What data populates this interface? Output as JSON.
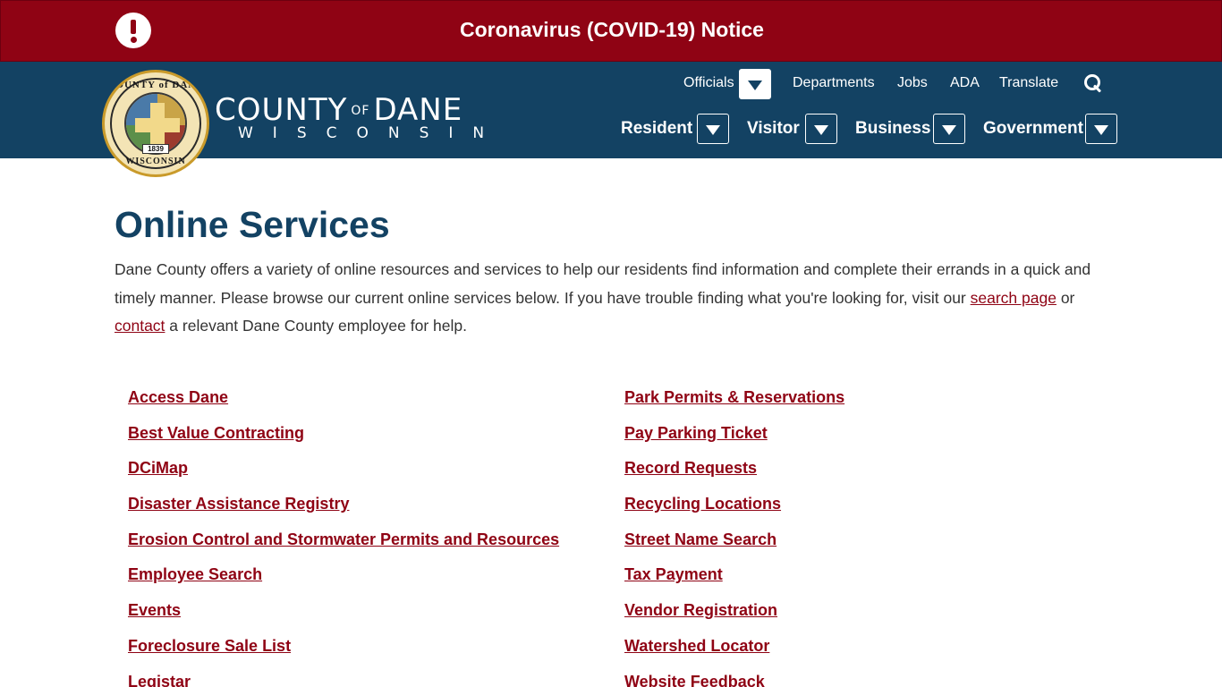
{
  "alert": {
    "icon": "exclamation-circle-icon",
    "text": "Coronavirus (COVID-19) Notice"
  },
  "branding": {
    "seal_top": "COUNTY of DANE",
    "seal_bottom": "WISCONSIN",
    "seal_year": "1839",
    "county": "COUNTY",
    "of": "OF",
    "dane": "DANE",
    "state": "WISCONSIN"
  },
  "top_nav": {
    "officials": "Officials",
    "departments": "Departments",
    "jobs": "Jobs",
    "ada": "ADA",
    "translate": "Translate",
    "search_icon": "search-icon"
  },
  "main_nav": {
    "resident": "Resident",
    "visitor": "Visitor",
    "business": "Business",
    "government": "Government"
  },
  "page": {
    "title": "Online Services",
    "intro_part1": "Dane County offers a variety of online resources and services to help our residents find information and complete their errands in a quick and timely manner. Please browse our current online services below. If you have trouble finding what you're looking for, visit our ",
    "intro_link1": "search page",
    "intro_part2": " or ",
    "intro_link2": "contact",
    "intro_part3": " a relevant Dane County employee for help."
  },
  "services_left": [
    "Access Dane",
    "Best Value Contracting",
    "DCiMap",
    "Disaster Assistance Registry",
    "Erosion Control and Stormwater Permits and Resources",
    "Employee Search",
    "Events",
    "Foreclosure Sale List",
    "Legistar"
  ],
  "services_right": [
    "Park Permits & Reservations",
    "Pay Parking Ticket",
    "Record Requests",
    "Recycling Locations",
    "Street Name Search",
    "Tax Payment",
    "Vendor Registration",
    "Watershed Locator",
    "Website Feedback"
  ],
  "colors": {
    "alert_red": "#8f0314",
    "header_blue": "#134263",
    "link_red": "#8f0314",
    "title_blue": "#134263"
  }
}
